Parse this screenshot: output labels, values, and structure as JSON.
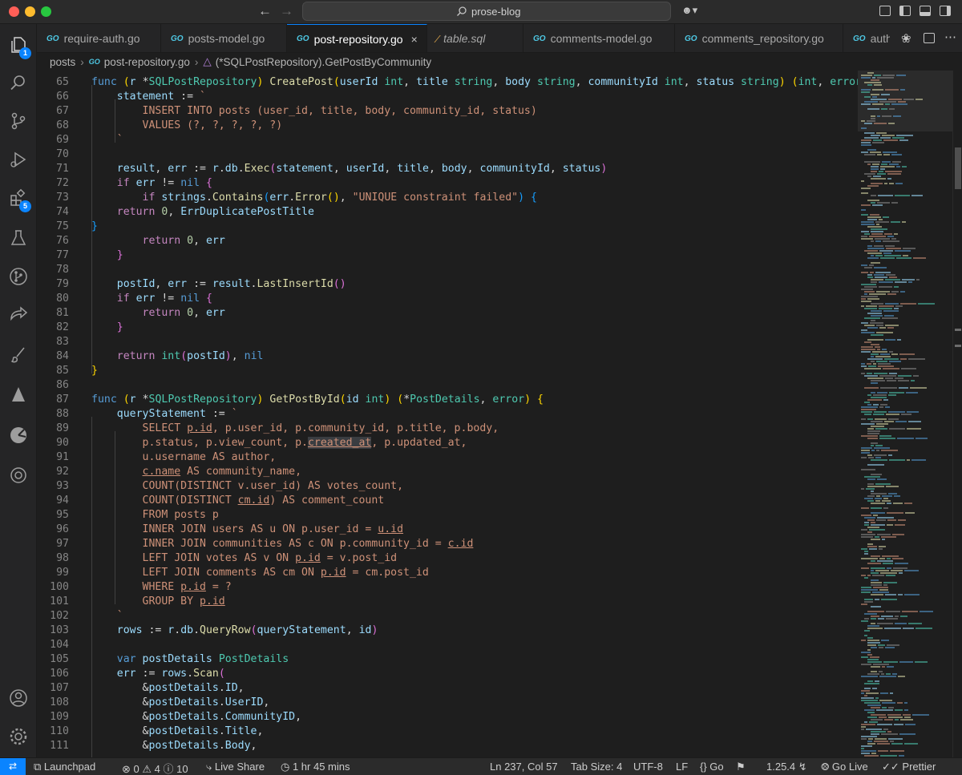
{
  "window": {
    "command_center": "prose-blog"
  },
  "activity_bar": {
    "items": [
      {
        "name": "explorer",
        "badge": "1"
      },
      {
        "name": "search"
      },
      {
        "name": "source-control"
      },
      {
        "name": "run-debug"
      },
      {
        "name": "extensions",
        "badge": "5"
      },
      {
        "name": "testing"
      },
      {
        "name": "git-graph"
      },
      {
        "name": "remote-share"
      },
      {
        "name": "paintbrush"
      },
      {
        "name": "sail"
      },
      {
        "name": "pie"
      },
      {
        "name": "chatgpt"
      }
    ],
    "bottom": [
      {
        "name": "account"
      },
      {
        "name": "settings"
      }
    ]
  },
  "tabs": [
    {
      "label": "require-auth.go",
      "icon": "go"
    },
    {
      "label": "posts-model.go",
      "icon": "go"
    },
    {
      "label": "post-repository.go",
      "icon": "go",
      "active": true
    },
    {
      "label": "table.sql",
      "icon": "sql",
      "italic": true
    },
    {
      "label": "comments-model.go",
      "icon": "go"
    },
    {
      "label": "comments_repository.go",
      "icon": "go"
    },
    {
      "label": "auth",
      "icon": "go"
    }
  ],
  "breadcrumb": {
    "folder": "posts",
    "file": "post-repository.go",
    "symbol": "(*SQLPostRepository).GetPostByCommunity"
  },
  "editor": {
    "first_line": 65,
    "lines": [
      [
        [
          "func",
          "kw"
        ],
        [
          " ",
          ""
        ],
        [
          "(",
          "b1"
        ],
        [
          "r ",
          "var"
        ],
        [
          "*",
          ""
        ],
        [
          "SQLPostRepository",
          "ty"
        ],
        [
          ")",
          "b1"
        ],
        [
          " ",
          ""
        ],
        [
          "CreatePost",
          "fn"
        ],
        [
          "(",
          "b1"
        ],
        [
          "userId ",
          "var"
        ],
        [
          "int",
          "ty"
        ],
        [
          ", ",
          ""
        ],
        [
          "title ",
          "var"
        ],
        [
          "string",
          "ty"
        ],
        [
          ", ",
          ""
        ],
        [
          "body ",
          "var"
        ],
        [
          "string",
          "ty"
        ],
        [
          ", ",
          ""
        ],
        [
          "communityId ",
          "var"
        ],
        [
          "int",
          "ty"
        ],
        [
          ", ",
          ""
        ],
        [
          "status ",
          "var"
        ],
        [
          "string",
          "ty"
        ],
        [
          ")",
          "b1"
        ],
        [
          " ",
          ""
        ],
        [
          "(",
          "b1"
        ],
        [
          "int",
          "ty"
        ],
        [
          ", ",
          ""
        ],
        [
          "error",
          "ty"
        ],
        [
          ")",
          "b1"
        ],
        [
          " ",
          ""
        ],
        [
          "{",
          "b1"
        ]
      ],
      [
        [
          "    statement ",
          "var"
        ],
        [
          ":= ",
          ""
        ],
        [
          "`",
          "str"
        ]
      ],
      [
        [
          "        INSERT INTO posts (user_id, title, body, community_id, status)",
          "str"
        ]
      ],
      [
        [
          "        VALUES (?, ?, ?, ?, ?)",
          "str"
        ]
      ],
      [
        [
          "    `",
          "str"
        ]
      ],
      [],
      [
        [
          "    result",
          "var"
        ],
        [
          ", ",
          ""
        ],
        [
          "err ",
          "var"
        ],
        [
          ":= ",
          ""
        ],
        [
          "r",
          "var"
        ],
        [
          ".",
          ""
        ],
        [
          "db",
          "var"
        ],
        [
          ".",
          ""
        ],
        [
          "Exec",
          "fn"
        ],
        [
          "(",
          "b2"
        ],
        [
          "statement",
          "var"
        ],
        [
          ", ",
          ""
        ],
        [
          "userId",
          "var"
        ],
        [
          ", ",
          ""
        ],
        [
          "title",
          "var"
        ],
        [
          ", ",
          ""
        ],
        [
          "body",
          "var"
        ],
        [
          ", ",
          ""
        ],
        [
          "communityId",
          "var"
        ],
        [
          ", ",
          ""
        ],
        [
          "status",
          "var"
        ],
        [
          ")",
          "b2"
        ]
      ],
      [
        [
          "    ",
          ""
        ],
        [
          "if",
          "ctrl"
        ],
        [
          " err ",
          "var"
        ],
        [
          "!= ",
          ""
        ],
        [
          "nil",
          "kw"
        ],
        [
          " ",
          ""
        ],
        [
          "{",
          "b2"
        ]
      ],
      [
        [
          "        ",
          ""
        ],
        [
          "if",
          "ctrl"
        ],
        [
          " strings",
          "var"
        ],
        [
          ".",
          ""
        ],
        [
          "Contains",
          "fn"
        ],
        [
          "(",
          "b3"
        ],
        [
          "err",
          "var"
        ],
        [
          ".",
          ""
        ],
        [
          "Error",
          "fn"
        ],
        [
          "()",
          "b1"
        ],
        [
          ", ",
          ""
        ],
        [
          "\"UNIQUE constraint failed\"",
          "str"
        ],
        [
          ")",
          "b3"
        ],
        [
          " ",
          ""
        ],
        [
          "{",
          "b3"
        ]
      ],
      [
        [
          "    ",
          ""
        ],
        [
          "return",
          "ctrl"
        ],
        [
          " ",
          ""
        ],
        [
          "0",
          "num"
        ],
        [
          ", ",
          ""
        ],
        [
          "ErrDuplicatePostTitle",
          "var"
        ]
      ],
      [
        [
          "}",
          "b3"
        ]
      ],
      [
        [
          "        ",
          ""
        ],
        [
          "return",
          "ctrl"
        ],
        [
          " ",
          ""
        ],
        [
          "0",
          "num"
        ],
        [
          ", ",
          ""
        ],
        [
          "err",
          "var"
        ]
      ],
      [
        [
          "    ",
          ""
        ],
        [
          "}",
          "b2"
        ]
      ],
      [],
      [
        [
          "    postId",
          "var"
        ],
        [
          ", ",
          ""
        ],
        [
          "err ",
          "var"
        ],
        [
          ":= ",
          ""
        ],
        [
          "result",
          "var"
        ],
        [
          ".",
          ""
        ],
        [
          "LastInsertId",
          "fn"
        ],
        [
          "()",
          "b2"
        ]
      ],
      [
        [
          "    ",
          ""
        ],
        [
          "if",
          "ctrl"
        ],
        [
          " err ",
          "var"
        ],
        [
          "!= ",
          ""
        ],
        [
          "nil",
          "kw"
        ],
        [
          " ",
          ""
        ],
        [
          "{",
          "b2"
        ]
      ],
      [
        [
          "        ",
          ""
        ],
        [
          "return",
          "ctrl"
        ],
        [
          " ",
          ""
        ],
        [
          "0",
          "num"
        ],
        [
          ", ",
          ""
        ],
        [
          "err",
          "var"
        ]
      ],
      [
        [
          "    ",
          ""
        ],
        [
          "}",
          "b2"
        ]
      ],
      [],
      [
        [
          "    ",
          ""
        ],
        [
          "return",
          "ctrl"
        ],
        [
          " ",
          ""
        ],
        [
          "int",
          "ty"
        ],
        [
          "(",
          "b2"
        ],
        [
          "postId",
          "var"
        ],
        [
          ")",
          "b2"
        ],
        [
          ", ",
          ""
        ],
        [
          "nil",
          "kw"
        ]
      ],
      [
        [
          "}",
          "b1"
        ]
      ],
      [],
      [
        [
          "func",
          "kw"
        ],
        [
          " ",
          ""
        ],
        [
          "(",
          "b1"
        ],
        [
          "r ",
          "var"
        ],
        [
          "*",
          ""
        ],
        [
          "SQLPostRepository",
          "ty"
        ],
        [
          ")",
          "b1"
        ],
        [
          " ",
          ""
        ],
        [
          "GetPostById",
          "fn"
        ],
        [
          "(",
          "b1"
        ],
        [
          "id ",
          "var"
        ],
        [
          "int",
          "ty"
        ],
        [
          ")",
          "b1"
        ],
        [
          " ",
          ""
        ],
        [
          "(",
          "b1"
        ],
        [
          "*",
          ""
        ],
        [
          "PostDetails",
          "ty"
        ],
        [
          ", ",
          ""
        ],
        [
          "error",
          "ty"
        ],
        [
          ")",
          "b1"
        ],
        [
          " ",
          ""
        ],
        [
          "{",
          "b1"
        ]
      ],
      [
        [
          "    queryStatement ",
          "var"
        ],
        [
          ":= ",
          ""
        ],
        [
          "`",
          "str"
        ]
      ],
      [
        [
          "        SELECT ",
          "str"
        ],
        [
          "p.id",
          "str ul"
        ],
        [
          ", p.user_id, p.community_id, p.title, p.body,",
          "str"
        ]
      ],
      [
        [
          "        p.status, p.view_count, p.",
          "str"
        ],
        [
          "created_at",
          "str ul hl"
        ],
        [
          ", p.updated_at,",
          "str"
        ]
      ],
      [
        [
          "        u.username AS author,",
          "str"
        ]
      ],
      [
        [
          "        ",
          "str"
        ],
        [
          "c.name",
          "str ul"
        ],
        [
          " AS community_name,",
          "str"
        ]
      ],
      [
        [
          "        COUNT(DISTINCT v.user_id) AS votes_count,",
          "str"
        ]
      ],
      [
        [
          "        COUNT(DISTINCT ",
          "str"
        ],
        [
          "cm.id",
          "str ul"
        ],
        [
          ") AS comment_count",
          "str"
        ]
      ],
      [
        [
          "        FROM posts p",
          "str"
        ]
      ],
      [
        [
          "        INNER JOIN users AS u ON p.user_id = ",
          "str"
        ],
        [
          "u.id",
          "str ul"
        ]
      ],
      [
        [
          "        INNER JOIN communities AS c ON p.community_id = ",
          "str"
        ],
        [
          "c.id",
          "str ul"
        ]
      ],
      [
        [
          "        LEFT JOIN votes AS v ON ",
          "str"
        ],
        [
          "p.id",
          "str ul"
        ],
        [
          " = v.post_id",
          "str"
        ]
      ],
      [
        [
          "        LEFT JOIN comments AS cm ON ",
          "str"
        ],
        [
          "p.id",
          "str ul"
        ],
        [
          " = cm.post_id",
          "str"
        ]
      ],
      [
        [
          "        WHERE ",
          "str"
        ],
        [
          "p.id",
          "str ul"
        ],
        [
          " = ?",
          "str"
        ]
      ],
      [
        [
          "        GROUP BY ",
          "str"
        ],
        [
          "p.id",
          "str ul"
        ]
      ],
      [
        [
          "    `",
          "str"
        ]
      ],
      [
        [
          "    rows ",
          "var"
        ],
        [
          ":= ",
          ""
        ],
        [
          "r",
          "var"
        ],
        [
          ".",
          ""
        ],
        [
          "db",
          "var"
        ],
        [
          ".",
          ""
        ],
        [
          "QueryRow",
          "fn"
        ],
        [
          "(",
          "b2"
        ],
        [
          "queryStatement",
          "var"
        ],
        [
          ", ",
          ""
        ],
        [
          "id",
          "var"
        ],
        [
          ")",
          "b2"
        ]
      ],
      [],
      [
        [
          "    ",
          ""
        ],
        [
          "var",
          "kw"
        ],
        [
          " postDetails ",
          "var"
        ],
        [
          "PostDetails",
          "ty"
        ]
      ],
      [
        [
          "    err ",
          "var"
        ],
        [
          ":= ",
          ""
        ],
        [
          "rows",
          "var"
        ],
        [
          ".",
          ""
        ],
        [
          "Scan",
          "fn"
        ],
        [
          "(",
          "b2"
        ]
      ],
      [
        [
          "        &",
          ""
        ],
        [
          "postDetails",
          "var"
        ],
        [
          ".",
          ""
        ],
        [
          "ID",
          "var"
        ],
        [
          ",",
          ""
        ]
      ],
      [
        [
          "        &",
          ""
        ],
        [
          "postDetails",
          "var"
        ],
        [
          ".",
          ""
        ],
        [
          "UserID",
          "var"
        ],
        [
          ",",
          ""
        ]
      ],
      [
        [
          "        &",
          ""
        ],
        [
          "postDetails",
          "var"
        ],
        [
          ".",
          ""
        ],
        [
          "CommunityID",
          "var"
        ],
        [
          ",",
          ""
        ]
      ],
      [
        [
          "        &",
          ""
        ],
        [
          "postDetails",
          "var"
        ],
        [
          ".",
          ""
        ],
        [
          "Title",
          "var"
        ],
        [
          ",",
          ""
        ]
      ],
      [
        [
          "        &",
          ""
        ],
        [
          "postDetails",
          "var"
        ],
        [
          ".",
          ""
        ],
        [
          "Body",
          "var"
        ],
        [
          ",",
          ""
        ]
      ]
    ]
  },
  "status_bar": {
    "launchpad": "Launchpad",
    "errors": "0",
    "warnings": "4",
    "infos": "10",
    "live_share": "Live Share",
    "time": "1 hr 45 mins",
    "cursor": "Ln 237, Col 57",
    "tab_size": "Tab Size: 4",
    "encoding": "UTF-8",
    "eol": "LF",
    "language": "Go",
    "go_version": "1.25.4",
    "go_live": "Go Live",
    "prettier": "Prettier"
  },
  "colors": {
    "accent": "#0a84ff",
    "background": "#1e1e1e"
  }
}
